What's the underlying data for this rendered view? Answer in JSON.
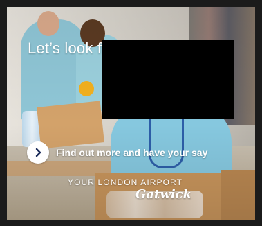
{
  "ad": {
    "headline": "Let’s look f",
    "cta_label": "Find out more and have your say",
    "tagline": "YOUR LONDON AIRPORT",
    "logo_text": "Gatwick",
    "colors": {
      "frame": "#1b1b1b",
      "text": "#ffffff",
      "cta_circle": "#ffffff",
      "cta_icon": "#1b2b5a",
      "redaction": "#000000"
    },
    "icons": {
      "cta": "chevron-right-icon"
    }
  }
}
